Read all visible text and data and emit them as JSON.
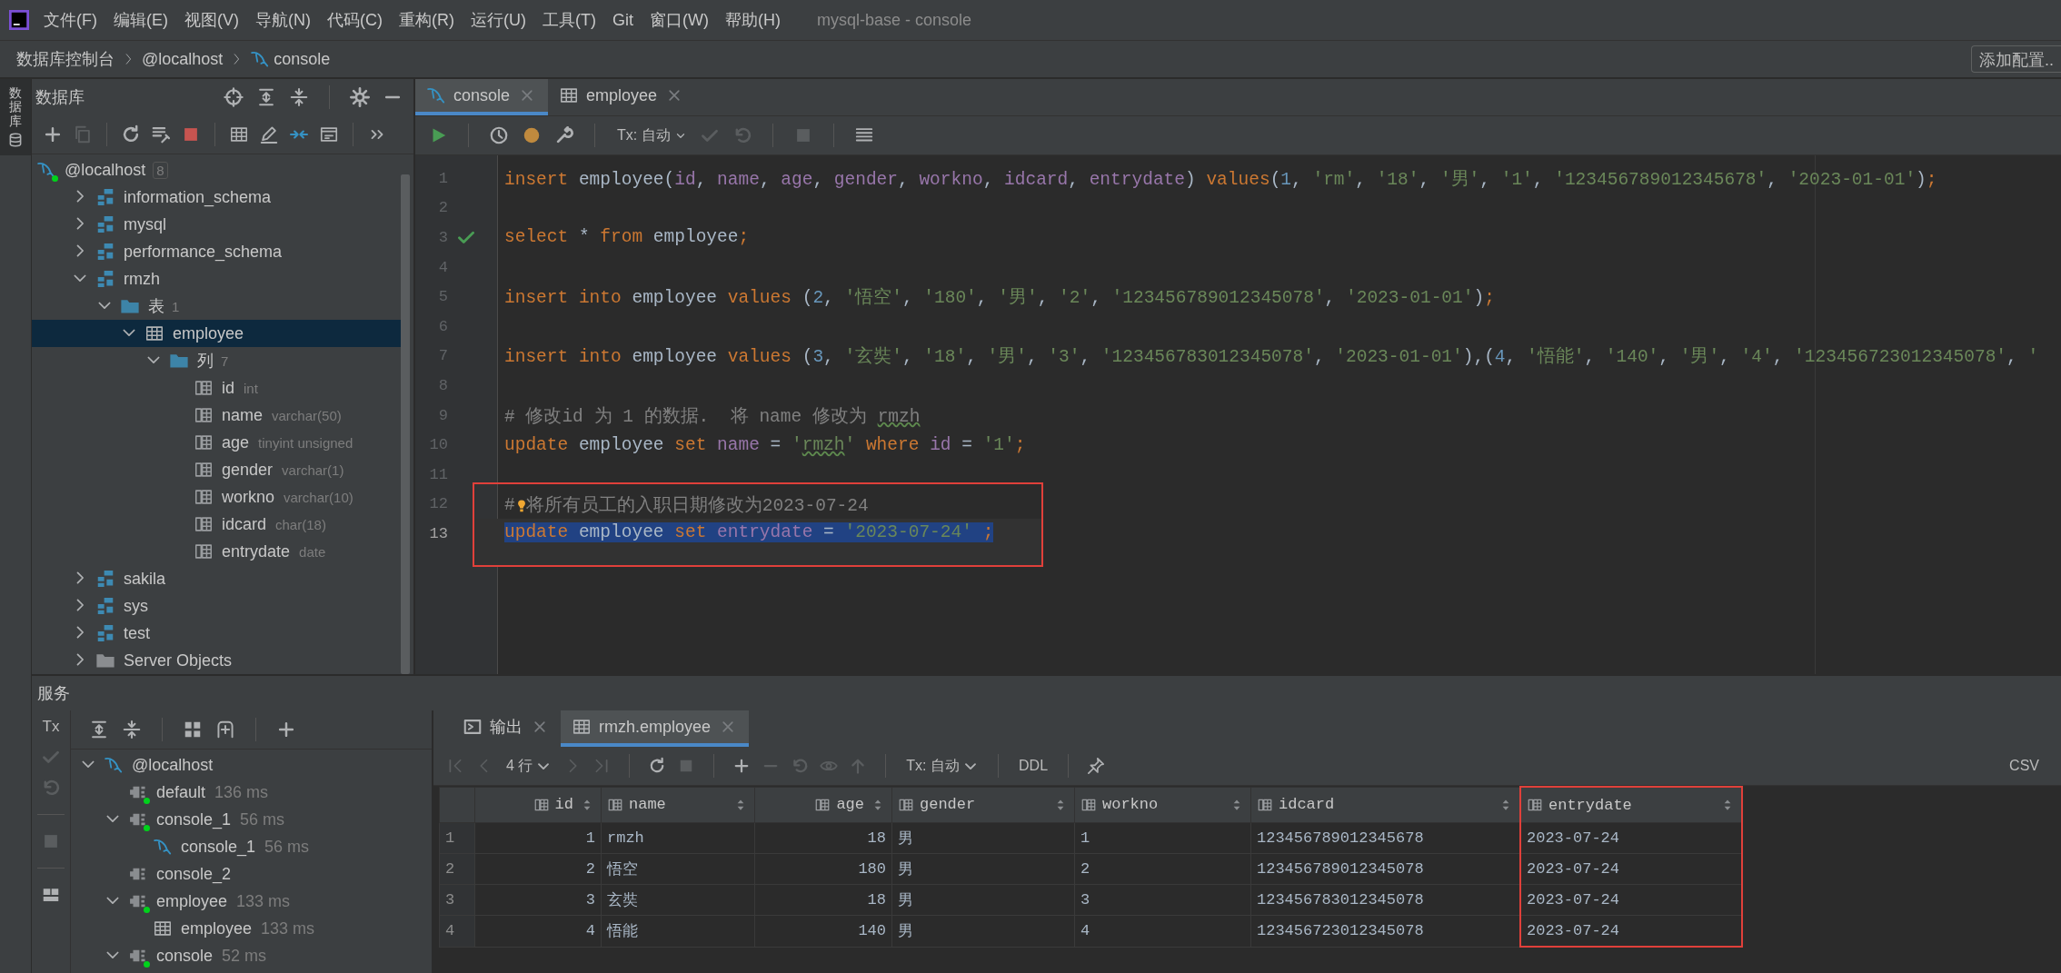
{
  "menu_bar": {
    "items": [
      "文件(F)",
      "编辑(E)",
      "视图(V)",
      "导航(N)",
      "代码(C)",
      "重构(R)",
      "运行(U)",
      "工具(T)",
      "Git",
      "窗口(W)",
      "帮助(H)"
    ],
    "title": "mysql-base - console"
  },
  "breadcrumb": {
    "items": [
      {
        "label": "数据库控制台",
        "kind": "text"
      },
      {
        "label": "@localhost",
        "kind": "text"
      },
      {
        "label": "console",
        "kind": "console"
      }
    ],
    "action": "添加配置.."
  },
  "side_strip": {
    "label": "数据库"
  },
  "database_panel": {
    "title": "数据库",
    "tree": [
      {
        "label": "@localhost",
        "kind": "connection",
        "count": "8",
        "connected": true,
        "selected": false,
        "children": [
          {
            "label": "information_schema",
            "kind": "schema",
            "expanded": false,
            "selected": false
          },
          {
            "label": "mysql",
            "kind": "schema",
            "expanded": false,
            "selected": false
          },
          {
            "label": "performance_schema",
            "kind": "schema",
            "expanded": false,
            "selected": false
          },
          {
            "label": "rmzh",
            "kind": "schema",
            "expanded": true,
            "selected": false,
            "children": [
              {
                "label": "表",
                "kind": "folder",
                "count": "1",
                "expanded": true,
                "selected": false,
                "children": [
                  {
                    "label": "employee",
                    "kind": "table",
                    "expanded": true,
                    "selected": true,
                    "children": [
                      {
                        "label": "列",
                        "kind": "folder",
                        "count": "7",
                        "expanded": true,
                        "selected": false,
                        "children": [
                          {
                            "label": "id",
                            "kind": "column",
                            "type": "int",
                            "selected": false
                          },
                          {
                            "label": "name",
                            "kind": "column",
                            "type": "varchar(50)",
                            "selected": false
                          },
                          {
                            "label": "age",
                            "kind": "column",
                            "type": "tinyint unsigned",
                            "selected": false
                          },
                          {
                            "label": "gender",
                            "kind": "column",
                            "type": "varchar(1)",
                            "selected": false
                          },
                          {
                            "label": "workno",
                            "kind": "column",
                            "type": "varchar(10)",
                            "selected": false
                          },
                          {
                            "label": "idcard",
                            "kind": "column",
                            "type": "char(18)",
                            "selected": false
                          },
                          {
                            "label": "entrydate",
                            "kind": "column",
                            "type": "date",
                            "selected": false
                          }
                        ]
                      }
                    ]
                  }
                ]
              }
            ]
          },
          {
            "label": "sakila",
            "kind": "schema",
            "expanded": false,
            "selected": false
          },
          {
            "label": "sys",
            "kind": "schema",
            "expanded": false,
            "selected": false
          },
          {
            "label": "test",
            "kind": "schema",
            "expanded": false,
            "selected": false
          },
          {
            "label": "Server Objects",
            "kind": "server_objects",
            "expanded": false,
            "selected": false
          }
        ]
      }
    ]
  },
  "editor": {
    "tabs": [
      {
        "label": "console",
        "kind": "console",
        "selected": true
      },
      {
        "label": "employee",
        "kind": "table",
        "selected": false
      }
    ],
    "tx_mode": "Tx: 自动",
    "lines": [
      {
        "number": "1",
        "executed": false,
        "selected": false,
        "outlined": false,
        "segments": [
          {
            "kind": "keyword",
            "text": "insert"
          },
          {
            "kind": "plain",
            "text": " employee("
          },
          {
            "kind": "column",
            "text": "id"
          },
          {
            "kind": "plain",
            "text": ", "
          },
          {
            "kind": "column",
            "text": "name"
          },
          {
            "kind": "plain",
            "text": ", "
          },
          {
            "kind": "column",
            "text": "age"
          },
          {
            "kind": "plain",
            "text": ", "
          },
          {
            "kind": "column",
            "text": "gender"
          },
          {
            "kind": "plain",
            "text": ", "
          },
          {
            "kind": "column",
            "text": "workno"
          },
          {
            "kind": "plain",
            "text": ", "
          },
          {
            "kind": "column",
            "text": "idcard"
          },
          {
            "kind": "plain",
            "text": ", "
          },
          {
            "kind": "column",
            "text": "entrydate"
          },
          {
            "kind": "plain",
            "text": ") "
          },
          {
            "kind": "keyword",
            "text": "values"
          },
          {
            "kind": "plain",
            "text": "("
          },
          {
            "kind": "number",
            "text": "1"
          },
          {
            "kind": "plain",
            "text": ", "
          },
          {
            "kind": "string",
            "text": "'rm'"
          },
          {
            "kind": "plain",
            "text": ", "
          },
          {
            "kind": "string",
            "text": "'18'"
          },
          {
            "kind": "plain",
            "text": ", "
          },
          {
            "kind": "string",
            "text": "'男'"
          },
          {
            "kind": "plain",
            "text": ", "
          },
          {
            "kind": "string",
            "text": "'1'"
          },
          {
            "kind": "plain",
            "text": ", "
          },
          {
            "kind": "string",
            "text": "'123456789012345678'"
          },
          {
            "kind": "plain",
            "text": ", "
          },
          {
            "kind": "string",
            "text": "'2023-01-01'"
          },
          {
            "kind": "plain",
            "text": ")"
          },
          {
            "kind": "keyword",
            "text": ";"
          }
        ]
      },
      {
        "number": "2",
        "executed": false,
        "selected": false,
        "outlined": false
      },
      {
        "number": "3",
        "executed": true,
        "selected": false,
        "outlined": false,
        "segments": [
          {
            "kind": "keyword",
            "text": "select"
          },
          {
            "kind": "plain",
            "text": " * "
          },
          {
            "kind": "keyword",
            "text": "from"
          },
          {
            "kind": "plain",
            "text": " employee"
          },
          {
            "kind": "keyword",
            "text": ";"
          }
        ]
      },
      {
        "number": "4",
        "executed": false,
        "selected": false,
        "outlined": false
      },
      {
        "number": "5",
        "executed": false,
        "selected": false,
        "outlined": false,
        "segments": [
          {
            "kind": "keyword",
            "text": "insert into"
          },
          {
            "kind": "plain",
            "text": " employee "
          },
          {
            "kind": "keyword",
            "text": "values"
          },
          {
            "kind": "plain",
            "text": " ("
          },
          {
            "kind": "number",
            "text": "2"
          },
          {
            "kind": "plain",
            "text": ", "
          },
          {
            "kind": "string",
            "text": "'悟空'"
          },
          {
            "kind": "plain",
            "text": ", "
          },
          {
            "kind": "string",
            "text": "'180'"
          },
          {
            "kind": "plain",
            "text": ", "
          },
          {
            "kind": "string",
            "text": "'男'"
          },
          {
            "kind": "plain",
            "text": ", "
          },
          {
            "kind": "string",
            "text": "'2'"
          },
          {
            "kind": "plain",
            "text": ", "
          },
          {
            "kind": "string",
            "text": "'123456789012345078'"
          },
          {
            "kind": "plain",
            "text": ", "
          },
          {
            "kind": "string",
            "text": "'2023-01-01'"
          },
          {
            "kind": "plain",
            "text": ")"
          },
          {
            "kind": "keyword",
            "text": ";"
          }
        ]
      },
      {
        "number": "6",
        "executed": false,
        "selected": false,
        "outlined": false
      },
      {
        "number": "7",
        "executed": false,
        "selected": false,
        "outlined": false,
        "segments": [
          {
            "kind": "keyword",
            "text": "insert into"
          },
          {
            "kind": "plain",
            "text": " employee "
          },
          {
            "kind": "keyword",
            "text": "values"
          },
          {
            "kind": "plain",
            "text": " ("
          },
          {
            "kind": "number",
            "text": "3"
          },
          {
            "kind": "plain",
            "text": ", "
          },
          {
            "kind": "string",
            "text": "'玄奘'"
          },
          {
            "kind": "plain",
            "text": ", "
          },
          {
            "kind": "string",
            "text": "'18'"
          },
          {
            "kind": "plain",
            "text": ", "
          },
          {
            "kind": "string",
            "text": "'男'"
          },
          {
            "kind": "plain",
            "text": ", "
          },
          {
            "kind": "string",
            "text": "'3'"
          },
          {
            "kind": "plain",
            "text": ", "
          },
          {
            "kind": "string",
            "text": "'123456783012345078'"
          },
          {
            "kind": "plain",
            "text": ", "
          },
          {
            "kind": "string",
            "text": "'2023-01-01'"
          },
          {
            "kind": "plain",
            "text": "),("
          },
          {
            "kind": "number",
            "text": "4"
          },
          {
            "kind": "plain",
            "text": ", "
          },
          {
            "kind": "string",
            "text": "'悟能'"
          },
          {
            "kind": "plain",
            "text": ", "
          },
          {
            "kind": "string",
            "text": "'140'"
          },
          {
            "kind": "plain",
            "text": ", "
          },
          {
            "kind": "string",
            "text": "'男'"
          },
          {
            "kind": "plain",
            "text": ", "
          },
          {
            "kind": "string",
            "text": "'4'"
          },
          {
            "kind": "plain",
            "text": ", "
          },
          {
            "kind": "string",
            "text": "'123456723012345078'"
          },
          {
            "kind": "plain",
            "text": ", "
          },
          {
            "kind": "string",
            "text": "'"
          }
        ]
      },
      {
        "number": "8",
        "executed": false,
        "selected": false,
        "outlined": false
      },
      {
        "number": "9",
        "executed": false,
        "selected": false,
        "outlined": false,
        "segments": [
          {
            "kind": "comment",
            "text": "# 修改id 为 1 的数据.  将 name 修改为 "
          },
          {
            "kind": "comment_typo",
            "text": "rmzh"
          }
        ]
      },
      {
        "number": "10",
        "executed": false,
        "selected": false,
        "outlined": false,
        "segments": [
          {
            "kind": "keyword",
            "text": "update"
          },
          {
            "kind": "plain",
            "text": " employee "
          },
          {
            "kind": "keyword",
            "text": "set "
          },
          {
            "kind": "column",
            "text": "name"
          },
          {
            "kind": "plain",
            "text": " = "
          },
          {
            "kind": "string",
            "text": "'"
          },
          {
            "kind": "string_typo",
            "text": "rmzh"
          },
          {
            "kind": "string",
            "text": "' "
          },
          {
            "kind": "keyword",
            "text": "where "
          },
          {
            "kind": "column",
            "text": "id"
          },
          {
            "kind": "plain",
            "text": " = "
          },
          {
            "kind": "string",
            "text": "'1'"
          },
          {
            "kind": "keyword",
            "text": ";"
          }
        ]
      },
      {
        "number": "11",
        "executed": false,
        "selected": false,
        "outlined": false
      },
      {
        "number": "12",
        "executed": false,
        "selected": false,
        "outlined": true,
        "segments": [
          {
            "kind": "comment",
            "text": "#"
          },
          {
            "kind": "bulb"
          },
          {
            "kind": "comment",
            "text": "将所有员工的入职日期修改为2023-07-24"
          }
        ]
      },
      {
        "number": "13",
        "executed": false,
        "selected": true,
        "outlined": true,
        "segments": [
          {
            "kind": "keyword",
            "text": "update"
          },
          {
            "kind": "plain",
            "text": " employee "
          },
          {
            "kind": "keyword",
            "text": "set "
          },
          {
            "kind": "column",
            "text": "entrydate"
          },
          {
            "kind": "plain",
            "text": " = "
          },
          {
            "kind": "string",
            "text": "'2023-07-24' "
          },
          {
            "kind": "keyword",
            "text": ";"
          }
        ]
      }
    ]
  },
  "services": {
    "title": "服务",
    "tx_label": "Tx",
    "tree": [
      {
        "label": "@localhost",
        "kind": "connection",
        "connected": false,
        "expanded": true,
        "selected": false,
        "children": [
          {
            "label": "default",
            "kind": "session",
            "time": "136 ms",
            "connected": true,
            "selected": false
          },
          {
            "label": "console_1",
            "kind": "session",
            "time": "56 ms",
            "connected": true,
            "expanded": true,
            "selected": false,
            "children": [
              {
                "label": "console_1",
                "kind": "console",
                "time": "56 ms",
                "selected": false
              }
            ]
          },
          {
            "label": "console_2",
            "kind": "session",
            "connected": false,
            "selected": false
          },
          {
            "label": "employee",
            "kind": "session",
            "time": "133 ms",
            "connected": true,
            "expanded": true,
            "selected": false,
            "children": [
              {
                "label": "employee",
                "kind": "table",
                "time": "133 ms",
                "selected": false
              }
            ]
          },
          {
            "label": "console",
            "kind": "session",
            "time": "52 ms",
            "connected": true,
            "expanded": true,
            "selected": false
          }
        ]
      }
    ]
  },
  "results": {
    "tabs": [
      {
        "label": "输出",
        "kind": "output",
        "selected": false
      },
      {
        "label": "rmzh.employee",
        "kind": "table",
        "selected": true
      }
    ],
    "toolbar": {
      "row_count": "4 行",
      "tx_mode": "Tx: 自动",
      "ddl": "DDL",
      "export": "CSV"
    },
    "table": {
      "columns": [
        {
          "name": "id",
          "numeric": true,
          "outlined": false
        },
        {
          "name": "name",
          "numeric": false,
          "outlined": false
        },
        {
          "name": "age",
          "numeric": true,
          "outlined": false
        },
        {
          "name": "gender",
          "numeric": false,
          "outlined": false
        },
        {
          "name": "workno",
          "numeric": false,
          "outlined": false
        },
        {
          "name": "idcard",
          "numeric": false,
          "outlined": false
        },
        {
          "name": "entrydate",
          "numeric": false,
          "outlined": true
        }
      ],
      "rows": [
        {
          "number": "1",
          "cells": [
            "1",
            "rmzh",
            "18",
            "男",
            "1",
            "123456789012345678",
            "2023-07-24"
          ]
        },
        {
          "number": "2",
          "cells": [
            "2",
            "悟空",
            "180",
            "男",
            "2",
            "123456789012345078",
            "2023-07-24"
          ]
        },
        {
          "number": "3",
          "cells": [
            "3",
            "玄奘",
            "18",
            "男",
            "3",
            "123456783012345078",
            "2023-07-24"
          ]
        },
        {
          "number": "4",
          "cells": [
            "4",
            "悟能",
            "140",
            "男",
            "4",
            "123456723012345078",
            "2023-07-24"
          ]
        }
      ]
    }
  }
}
